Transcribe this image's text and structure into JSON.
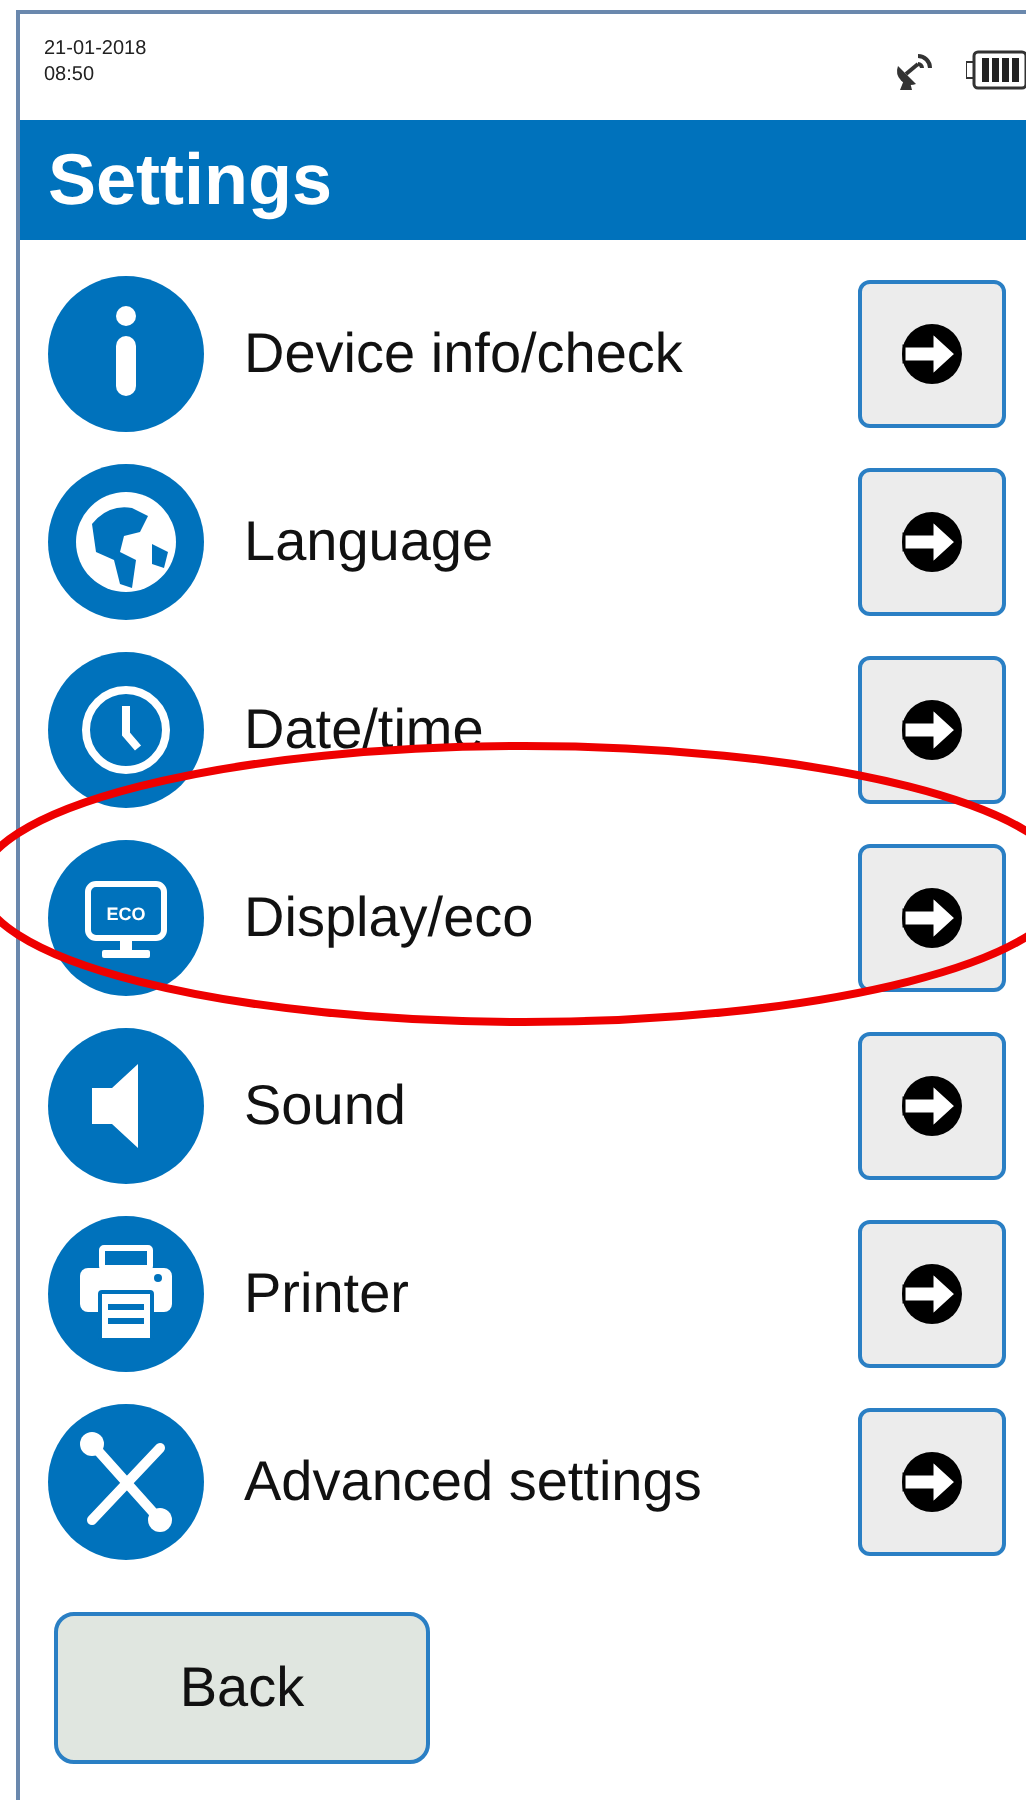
{
  "status_bar": {
    "date": "21-01-2018",
    "time": "08:50"
  },
  "header": {
    "title": "Settings"
  },
  "items": [
    {
      "label": "Device info/check",
      "highlighted": false
    },
    {
      "label": "Language",
      "highlighted": false
    },
    {
      "label": "Date/time",
      "highlighted": false
    },
    {
      "label": "Display/eco",
      "highlighted": true
    },
    {
      "label": "Sound",
      "highlighted": false
    },
    {
      "label": "Printer",
      "highlighted": false
    },
    {
      "label": "Advanced settings",
      "highlighted": false
    }
  ],
  "back_button": {
    "label": "Back"
  },
  "eco_label": "ECO"
}
